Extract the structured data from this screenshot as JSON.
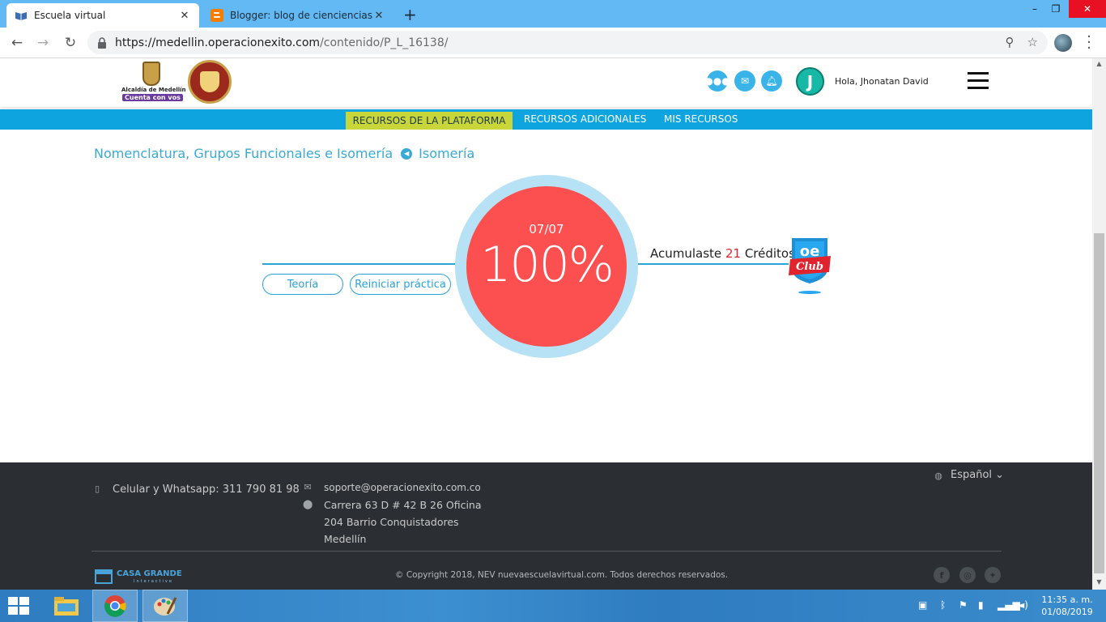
{
  "browser": {
    "tabs": [
      {
        "title": "Escuela virtual",
        "active": true
      },
      {
        "title": "Blogger: blog de cienciencias - C",
        "active": false
      }
    ],
    "new_tab": "+",
    "window_controls": {
      "minimize": "–",
      "maximize": "❐",
      "close": "✕"
    },
    "url_host": "https://medellin.operacionexito.com",
    "url_path": "/contenido/P_L_16138/",
    "icons": [
      "back-icon",
      "forward-icon",
      "reload-icon",
      "lock-icon",
      "zoom-icon",
      "star-icon",
      "profile-avatar",
      "menu-dots-icon"
    ]
  },
  "header": {
    "logo_medellin_line1": "Alcaldía de Medellín",
    "logo_medellin_line2": "Cuenta con vos",
    "logo_colombia": "República de Colombia",
    "avatar_letter": "J",
    "greeting": "Hola, Jhonatan David"
  },
  "menu": {
    "items": [
      "RECURSOS DE LA PLATAFORMA",
      "RECURSOS ADICIONALES",
      "MIS RECURSOS"
    ],
    "active_index": 0
  },
  "breadcrumb": {
    "parent": "Nomenclatura, Grupos Funcionales e Isomería",
    "current": "Isomería"
  },
  "result": {
    "fraction": "07/07",
    "percent": "100%",
    "buttons": {
      "theory": "Teoría",
      "restart": "Reiniciar práctica"
    },
    "credits_prefix": "Acumulaste",
    "credits_value": "21",
    "credits_suffix": "Créditos",
    "badge_top": "oe",
    "badge_bottom": "Club"
  },
  "footer": {
    "phone": "Celular y Whatsapp: 311 790 81 98",
    "email": "soporte@operacionexito.com.co",
    "address_line1": "Carrera 63 D # 42 B 26 Oficina",
    "address_line2": "204 Barrio Conquistadores",
    "address_line3": "Medellín",
    "language": "Español",
    "copyright": "© Copyright 2018, NEV nuevaescuelavirtual.com. Todos derechos reservados.",
    "brand": "CASA GRANDE",
    "brand_sub": "Interactive"
  },
  "taskbar": {
    "time": "11:35 a. m.",
    "date": "01/08/2019"
  },
  "colors": {
    "accent_blue": "#0ea4df",
    "menu_active": "#c8d63a",
    "score_red": "#fc4f50",
    "ring_blue": "#b7e2f6",
    "footer_bg": "#2b2f33"
  }
}
